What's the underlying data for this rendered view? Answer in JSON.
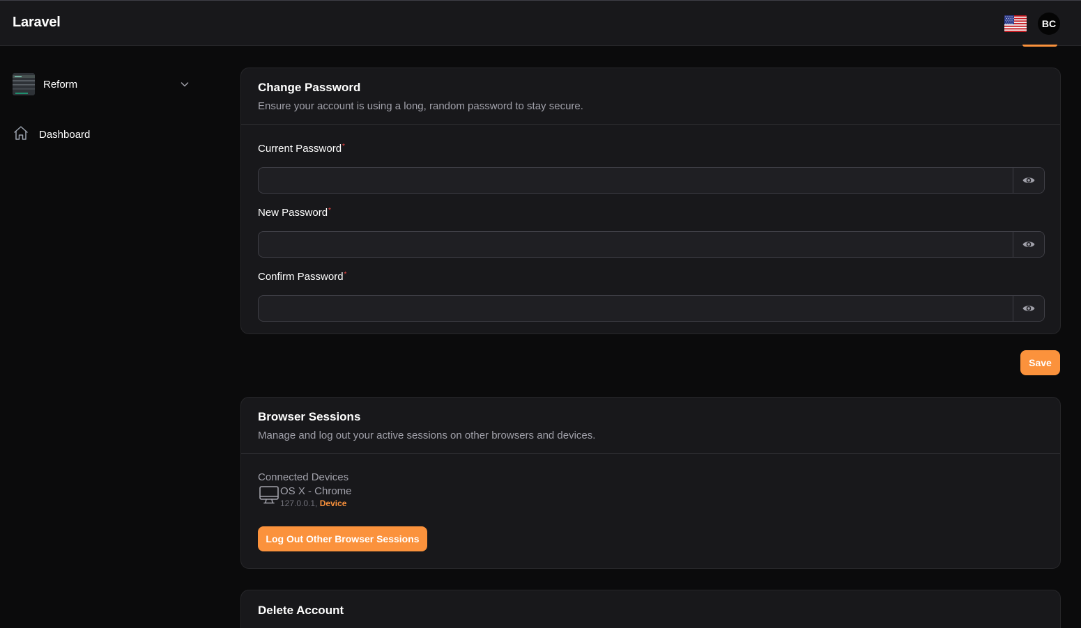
{
  "app": {
    "brand": "Laravel"
  },
  "header": {
    "avatar_initials": "BC",
    "locale_flag": "us-flag-icon"
  },
  "sidebar": {
    "team_name": "Reform",
    "items": [
      {
        "label": "Dashboard",
        "icon": "home-icon"
      }
    ]
  },
  "change_password": {
    "title": "Change Password",
    "description": "Ensure your account is using a long, random password to stay secure.",
    "fields": [
      {
        "label": "Current Password",
        "required_mark": "*",
        "value": ""
      },
      {
        "label": "New Password",
        "required_mark": "*",
        "value": ""
      },
      {
        "label": "Confirm Password",
        "required_mark": "*",
        "value": ""
      }
    ],
    "save_label": "Save"
  },
  "browser_sessions": {
    "title": "Browser Sessions",
    "description": "Manage and log out your active sessions on other browsers and devices.",
    "connected_label": "Connected Devices",
    "sessions": [
      {
        "device": "OS X - Chrome",
        "ip": "127.0.0.1,",
        "current_label": "Device"
      }
    ],
    "logout_label": "Log Out Other Browser Sessions"
  },
  "delete_account": {
    "title": "Delete Account"
  },
  "colors": {
    "accent": "#fb923c",
    "required": "#ef4444",
    "background": "#0b0b0c",
    "card": "#18181b"
  }
}
